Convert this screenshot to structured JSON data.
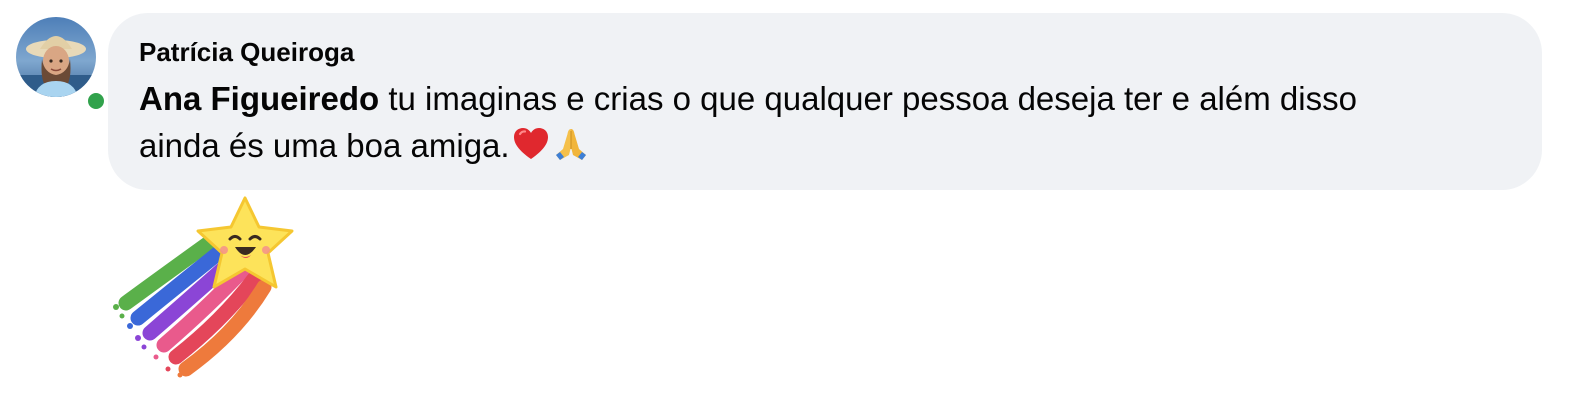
{
  "comment": {
    "author_name": "Patrícia Queiroga",
    "mention_name": "Ana Figueiredo",
    "text_line1": " tu imaginas e crias o que qualquer pessoa deseja ter e além disso",
    "text_line2": "ainda és uma boa amiga.",
    "emojis": [
      "heart-icon",
      "praying-hands-icon"
    ],
    "online_status_color": "#31a24c",
    "bubble_color": "#f0f2f5"
  },
  "sticker": {
    "icon": "shooting-star-rainbow-sticker"
  }
}
